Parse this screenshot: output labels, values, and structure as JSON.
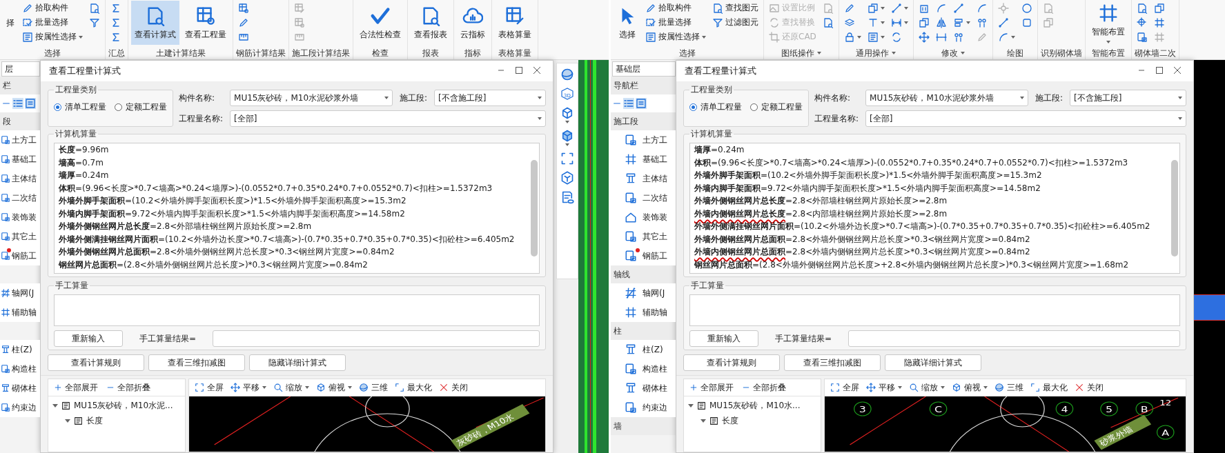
{
  "panes": [
    {
      "ribbon": [
        {
          "label": "选择",
          "menu": false,
          "columns": [
            [
              {
                "kind": "large",
                "label": "择"
              }
            ],
            [
              {
                "kind": "small",
                "label": "拾取构件"
              },
              {
                "kind": "small",
                "label": "批量选择"
              },
              {
                "kind": "small",
                "label": "按属性选择",
                "menu": true
              }
            ],
            [
              {
                "kind": "icon"
              },
              {
                "kind": "icon"
              }
            ]
          ]
        },
        {
          "label": "汇总",
          "menu": false,
          "columns": [
            [
              {
                "kind": "icon"
              },
              {
                "kind": "icon"
              },
              {
                "kind": "icon"
              }
            ]
          ]
        },
        {
          "label": "土建计算结果",
          "menu": false,
          "columns": [
            [
              {
                "kind": "large",
                "label": "查看计算式",
                "selected": true
              }
            ],
            [
              {
                "kind": "large",
                "label": "查看工程量",
                "selected": false
              }
            ]
          ]
        },
        {
          "label": "钢筋计算结果",
          "menu": false,
          "columns": [
            [
              {
                "kind": "icon"
              },
              {
                "kind": "icon"
              },
              {
                "kind": "icon"
              }
            ]
          ]
        },
        {
          "label": "施工段计算结果",
          "menu": false,
          "columns": [
            [
              {
                "kind": "icon",
                "disabled": true
              },
              {
                "kind": "icon",
                "disabled": true
              },
              {
                "kind": "icon",
                "disabled": true
              }
            ]
          ]
        },
        {
          "label": "检查",
          "menu": false,
          "columns": [
            [
              {
                "kind": "large",
                "label": "合法性检查",
                "selected": false
              }
            ]
          ]
        },
        {
          "label": "报表",
          "menu": false,
          "columns": [
            [
              {
                "kind": "large",
                "label": "查看报表",
                "selected": false
              }
            ]
          ]
        },
        {
          "label": "指标",
          "menu": false,
          "columns": [
            [
              {
                "kind": "large",
                "label": "云指标",
                "selected": false
              }
            ]
          ]
        },
        {
          "label": "表格算量",
          "menu": false,
          "columns": [
            [
              {
                "kind": "large",
                "label": "表格算量",
                "selected": false
              }
            ]
          ]
        }
      ],
      "sidebar": [
        {
          "kind": "tab",
          "label": "层"
        },
        {
          "kind": "header",
          "label": "栏"
        },
        {
          "kind": "toolbar"
        },
        {
          "kind": "header",
          "label": "段"
        },
        {
          "kind": "item",
          "label": "土方工",
          "marked": false
        },
        {
          "kind": "item",
          "label": "基础工",
          "marked": false
        },
        {
          "kind": "item",
          "label": "主体结",
          "marked": false
        },
        {
          "kind": "item",
          "label": "二次结",
          "marked": false
        },
        {
          "kind": "item",
          "label": "装饰装",
          "marked": false
        },
        {
          "kind": "item",
          "label": "其它土",
          "marked": false
        },
        {
          "kind": "item",
          "label": "钢筋工",
          "marked": true
        },
        {
          "kind": "gap"
        },
        {
          "kind": "item",
          "label": "轴网(J",
          "marked": false
        },
        {
          "kind": "item",
          "label": "辅助轴",
          "marked": false
        },
        {
          "kind": "gap"
        },
        {
          "kind": "item",
          "label": "柱(Z)",
          "marked": false
        },
        {
          "kind": "item",
          "label": "构造柱",
          "marked": false
        },
        {
          "kind": "item",
          "label": "砌体柱",
          "marked": false
        },
        {
          "kind": "item",
          "label": "约束边",
          "marked": false
        }
      ],
      "dialog": {
        "title": "查看工程量计算式",
        "category": {
          "legend": "工程量类别",
          "options": [
            {
              "label": "清单工程量",
              "selected": true
            },
            {
              "label": "定额工程量",
              "selected": false
            }
          ]
        },
        "fields": [
          {
            "label": "构件名称:",
            "value": "MU15灰砂砖，M10水泥砂浆外墙"
          },
          {
            "label": "施工段:",
            "value": "[不含施工段]"
          },
          {
            "label": "工程量名称:",
            "value": "[全部]"
          }
        ],
        "computed": {
          "legend": "计算机算量",
          "lines": [
            {
              "label": "长度",
              "formula": "=9.96m",
              "underlined": false
            },
            {
              "label": "墙高",
              "formula": "=0.7m",
              "underlined": false
            },
            {
              "label": "墙厚",
              "formula": "=0.24m",
              "underlined": false
            },
            {
              "label": "体积",
              "formula": "=(9.96<长度>*0.7<墙高>*0.24<墙厚>)-(0.0552*0.7+0.35*0.24*0.7+0.0552*0.7)<扣柱>=1.5372m3",
              "underlined": false
            },
            {
              "label": "外墙外脚手架面积",
              "formula": "=(10.2<外墙外脚手架面积长度>)*1.5<外墙外脚手架面积高度>=15.3m2",
              "underlined": false
            },
            {
              "label": "外墙内脚手架面积",
              "formula": "=9.72<外墙内脚手架面积长度>*1.5<外墙内脚手架面积高度>=14.58m2",
              "underlined": false
            },
            {
              "label": "外墙外侧钢丝网片总长度",
              "formula": "=2.8<外部墙柱钢丝网片原始长度>=2.8m",
              "underlined": false
            },
            {
              "label": "外墙外侧满挂钢丝网片面积",
              "formula": "=(10.2<外墙外边长度>*0.7<墙高>)-(0.7*0.35+0.7*0.35+0.7*0.35)<扣砼柱>=6.405m2",
              "underlined": false
            },
            {
              "label": "外墙外侧钢丝网片总面积",
              "formula": "=2.8<外墙外侧钢丝网片总长度>*0.3<钢丝网片宽度>=0.84m2",
              "underlined": false
            },
            {
              "label": "钢丝网片总面积",
              "formula": "=(2.8<外墙外侧钢丝网片总长度>)*0.3<钢丝网片宽度>=0.84m2",
              "underlined": false
            }
          ]
        },
        "manual": {
          "legend": "手工算量",
          "reset_button": "重新输入",
          "result_label": "手工算量结果="
        },
        "buttons": [
          "查看计算规则",
          "查看三维扣减图",
          "隐藏详细计算式"
        ],
        "tree": {
          "expand_all": "全部展开",
          "collapse_all": "全部折叠",
          "nodes": [
            {
              "label": "MU15灰砂砖，M10水泥...",
              "expanded": true,
              "children": [
                {
                  "label": "长度",
                  "expanded": true
                }
              ]
            }
          ]
        },
        "view": {
          "tools": [
            {
              "label": "全屏",
              "menu": false
            },
            {
              "label": "平移",
              "menu": true
            },
            {
              "label": "缩放",
              "menu": true
            },
            {
              "label": "俯视",
              "menu": true
            },
            {
              "label": "三维",
              "menu": false
            },
            {
              "label": "最大化",
              "menu": false
            },
            {
              "label": "关闭",
              "menu": false
            }
          ],
          "wall_label": "灰砂砖，M10水"
        }
      },
      "side": {
        "kind": "green",
        "tools": [
          {
            "menu": false
          },
          {
            "label": "3D",
            "menu": false
          },
          {
            "menu": true
          },
          {
            "menu": true
          },
          {
            "menu": false
          },
          {
            "menu": false
          },
          {
            "menu": false
          }
        ]
      }
    },
    {
      "ribbon": [
        {
          "label": "选择",
          "menu": false,
          "columns": [
            [
              {
                "kind": "large",
                "label": "选择",
                "selected": false
              }
            ],
            [
              {
                "kind": "small",
                "label": "拾取构件"
              },
              {
                "kind": "small",
                "label": "批量选择"
              },
              {
                "kind": "small",
                "label": "按属性选择",
                "menu": true
              }
            ],
            [
              {
                "kind": "small",
                "label": "查找图元"
              },
              {
                "kind": "small",
                "label": "过滤图元"
              }
            ]
          ]
        },
        {
          "label": "图纸操作",
          "menu": true,
          "columns": [
            [
              {
                "kind": "small",
                "label": "设置比例",
                "disabled": true
              },
              {
                "kind": "small",
                "label": "查找替换",
                "disabled": true
              },
              {
                "kind": "small",
                "label": "还原CAD",
                "disabled": true
              }
            ],
            [
              {
                "kind": "icon",
                "disabled": true
              },
              {
                "kind": "icon",
                "disabled": false
              }
            ]
          ]
        },
        {
          "label": "通用操作",
          "menu": true,
          "columns": [
            [
              {
                "kind": "icon",
                "menu": false
              },
              {
                "kind": "icon",
                "menu": false
              },
              {
                "kind": "icon",
                "menu": true
              }
            ],
            [
              {
                "kind": "icon",
                "menu": true
              },
              {
                "kind": "icon",
                "menu": true
              },
              {
                "kind": "icon",
                "menu": true
              }
            ],
            [
              {
                "kind": "icon",
                "menu": true
              },
              {
                "kind": "icon",
                "menu": true
              },
              {
                "kind": "icon",
                "menu": false
              }
            ]
          ]
        },
        {
          "label": "修改",
          "menu": true,
          "columns": [
            [
              {
                "kind": "icon"
              },
              {
                "kind": "icon"
              },
              {
                "kind": "icon"
              }
            ],
            [
              {
                "kind": "icon"
              },
              {
                "kind": "icon"
              },
              {
                "kind": "icon"
              }
            ],
            [
              {
                "kind": "icon",
                "menu": false
              },
              {
                "kind": "icon",
                "menu": true
              },
              {
                "kind": "icon",
                "menu": false
              }
            ],
            [
              {
                "kind": "icon",
                "disabled": false
              },
              {
                "kind": "icon",
                "disabled": false
              },
              {
                "kind": "icon",
                "disabled": true
              }
            ]
          ]
        },
        {
          "label": "绘图",
          "menu": false,
          "columns": [
            [
              {
                "kind": "icon",
                "disabled": true
              },
              {
                "kind": "icon"
              },
              {
                "kind": "icon",
                "menu": true
              }
            ],
            [
              {
                "kind": "icon"
              },
              {
                "kind": "icon"
              }
            ]
          ]
        },
        {
          "label": "识别砌体墙",
          "menu": false,
          "columns": [
            [
              {
                "kind": "icon",
                "disabled": true
              },
              {
                "kind": "icon",
                "disabled": true
              }
            ]
          ]
        },
        {
          "label": "智能布置",
          "menu": false,
          "columns": [
            [
              {
                "kind": "large",
                "label": "智能布置",
                "menu": true,
                "selected": false
              }
            ]
          ]
        },
        {
          "label": "砌体墙二次",
          "menu": false,
          "columns": [
            [
              {
                "kind": "icon"
              },
              {
                "kind": "icon"
              },
              {
                "kind": "icon"
              }
            ],
            [
              {
                "kind": "icon",
                "disabled": false
              },
              {
                "kind": "icon",
                "disabled": false
              },
              {
                "kind": "icon",
                "disabled": true
              }
            ]
          ]
        }
      ],
      "sidebar": [
        {
          "kind": "tab",
          "label": "基础层"
        },
        {
          "kind": "header",
          "label": "导航栏"
        },
        {
          "kind": "toolbar"
        },
        {
          "kind": "header",
          "label": "施工段"
        },
        {
          "kind": "item",
          "label": "土方工",
          "marked": false
        },
        {
          "kind": "item",
          "label": "基础工",
          "marked": false
        },
        {
          "kind": "item",
          "label": "主体结",
          "marked": false
        },
        {
          "kind": "item",
          "label": "二次结",
          "marked": false
        },
        {
          "kind": "item",
          "label": "装饰装",
          "marked": false
        },
        {
          "kind": "item",
          "label": "其它土",
          "marked": false
        },
        {
          "kind": "item",
          "label": "钢筋工",
          "marked": true
        },
        {
          "kind": "header",
          "label": "轴线"
        },
        {
          "kind": "item",
          "label": "轴网(J",
          "marked": false
        },
        {
          "kind": "item",
          "label": "辅助轴",
          "marked": false
        },
        {
          "kind": "header",
          "label": "柱"
        },
        {
          "kind": "item",
          "label": "柱(Z)",
          "marked": false
        },
        {
          "kind": "item",
          "label": "构造柱",
          "marked": false
        },
        {
          "kind": "item",
          "label": "砌体柱",
          "marked": false
        },
        {
          "kind": "item",
          "label": "约束边",
          "marked": false
        },
        {
          "kind": "header",
          "label": "墙"
        }
      ],
      "dialog": {
        "title": "查看工程量计算式",
        "category": {
          "legend": "工程量类别",
          "options": [
            {
              "label": "清单工程量",
              "selected": true
            },
            {
              "label": "定额工程量",
              "selected": false
            }
          ]
        },
        "fields": [
          {
            "label": "构件名称:",
            "value": "MU15灰砂砖，M10水泥砂浆外墙"
          },
          {
            "label": "施工段:",
            "value": "[不含施工段]"
          },
          {
            "label": "工程量名称:",
            "value": "[全部]"
          }
        ],
        "computed": {
          "legend": "计算机算量",
          "lines": [
            {
              "label": "墙厚",
              "formula": "=0.24m",
              "underlined": false
            },
            {
              "label": "体积",
              "formula": "=(9.96<长度>*0.7<墙高>*0.24<墙厚>)-(0.0552*0.7+0.35*0.24*0.7+0.0552*0.7)<扣柱>=1.5372m3",
              "underlined": false
            },
            {
              "label": "外墙外脚手架面积",
              "formula": "=(10.2<外墙外脚手架面积长度>)*1.5<外墙外脚手架面积高度>=15.3m2",
              "underlined": false
            },
            {
              "label": "外墙内脚手架面积",
              "formula": "=9.72<外墙内脚手架面积长度>*1.5<外墙内脚手架面积高度>=14.58m2",
              "underlined": false
            },
            {
              "label": "外墙外侧钢丝网片总长度",
              "formula": "=2.8<外部墙柱钢丝网片原始长度>=2.8m",
              "underlined": false
            },
            {
              "label": "外墙内侧钢丝网片总长度",
              "formula": "=2.8<内部墙柱钢丝网片原始长度>=2.8m",
              "underlined": true
            },
            {
              "label": "外墙外侧满挂钢丝网片面积",
              "formula": "=(10.2<外墙外边长度>*0.7<墙高>)-(0.7*0.35+0.7*0.35+0.7*0.35)<扣砼柱>=6.405m2",
              "underlined": false
            },
            {
              "label": "外墙外侧钢丝网片总面积",
              "formula": "=2.8<外墙外侧钢丝网片总长度>*0.3<钢丝网片宽度>=0.84m2",
              "underlined": false
            },
            {
              "label": "外墙内侧钢丝网片总面积",
              "formula": "=2.8<外墙内侧钢丝网片总长度>*0.3<钢丝网片宽度>=0.84m2",
              "underlined": true
            },
            {
              "label": "钢丝网片总面积",
              "formula": "=(2.8<外墙外侧钢丝网片总长度>+2.8<外墙内侧钢丝网片总长度>)*0.3<钢丝网片宽度>=1.68m2",
              "underlined": false
            }
          ]
        },
        "manual": {
          "legend": "手工算量",
          "reset_button": "重新输入",
          "result_label": "手工算量结果="
        },
        "buttons": [
          "查看计算规则",
          "查看三维扣减图",
          "隐藏详细计算式"
        ],
        "tree": {
          "expand_all": "全部展开",
          "collapse_all": "全部折叠",
          "nodes": [
            {
              "label": "MU15灰砂砖，M10水...",
              "expanded": true,
              "children": [
                {
                  "label": "长度",
                  "expanded": true
                }
              ]
            }
          ]
        },
        "view": {
          "tools": [
            {
              "label": "全屏",
              "menu": false
            },
            {
              "label": "平移",
              "menu": true
            },
            {
              "label": "缩放",
              "menu": true
            },
            {
              "label": "俯视",
              "menu": true
            },
            {
              "label": "三维",
              "menu": false
            },
            {
              "label": "最大化",
              "menu": false
            },
            {
              "label": "关闭",
              "menu": false
            }
          ],
          "axes": [
            "12",
            "3",
            "C",
            "4",
            "5",
            "B",
            "A"
          ],
          "wall_label": "砂浆外墙"
        }
      },
      "side": {
        "kind": "black"
      }
    }
  ]
}
